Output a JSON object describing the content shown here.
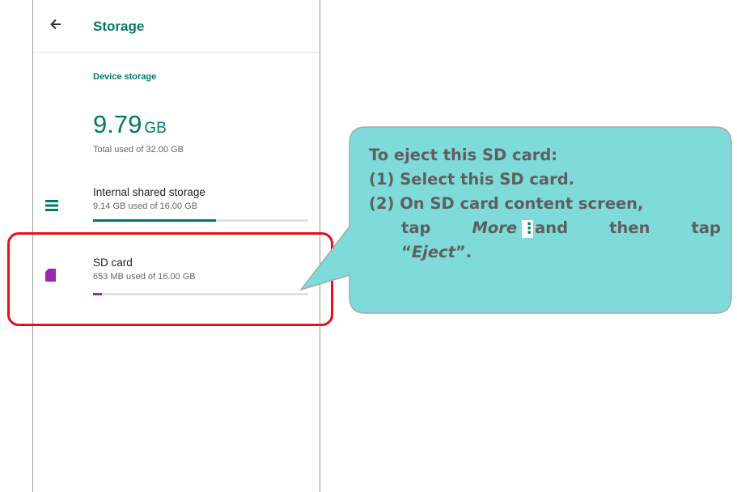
{
  "appbar": {
    "title": "Storage"
  },
  "device_storage": {
    "label": "Device storage",
    "total_value": "9.79",
    "total_unit": "GB",
    "total_sub": "Total used of 32.00 GB"
  },
  "items": [
    {
      "title": "Internal shared storage",
      "sub": "9.14 GB used of 16.00 GB",
      "usage": 0.571,
      "color": "#00796b",
      "icon": "storage-list-icon"
    },
    {
      "title": "SD card",
      "sub": "653 MB used of 16.00 GB",
      "usage": 0.04,
      "color": "#9c27b0",
      "icon": "sd-card-icon"
    }
  ],
  "callout": {
    "heading": "To eject this SD card:",
    "step1_num": "(1)",
    "step1_text": "Select this SD card.",
    "step2_num": "(2)",
    "step2_text": "On SD card content screen,",
    "step2_tap": "tap",
    "step2_more": "More",
    "step2_dot": "⋮",
    "step2_and": "and",
    "step2_then": "then",
    "step2_tap2": "tap",
    "step2_eject_open": "“",
    "step2_eject": "Eject",
    "step2_eject_close": "”.",
    "fill_color": "#7fdada",
    "border_color": "#a8a8a8"
  },
  "highlight_color": "#e1111f"
}
